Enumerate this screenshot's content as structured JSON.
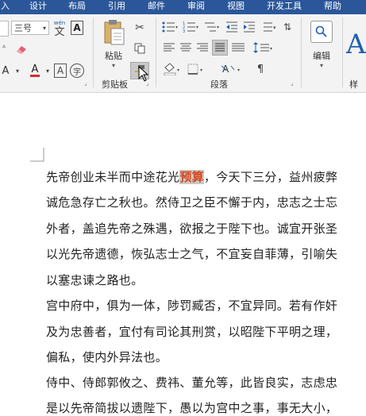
{
  "tabs": [
    "入",
    "设计",
    "布局",
    "引用",
    "邮件",
    "审阅",
    "视图",
    "开发工具",
    "帮助"
  ],
  "font": {
    "size_value": "三号",
    "wen_label": "wén"
  },
  "clipboard": {
    "paste_label": "粘贴",
    "group_label": "剪贴板"
  },
  "paragraph": {
    "group_label": "段落"
  },
  "editing": {
    "label": "编辑"
  },
  "styles": {
    "group_label": "样式"
  },
  "document": {
    "lines": [
      {
        "before": "先帝创业未半而中途花光",
        "highlight": "预算",
        "after": "，今天下三分，益州疲弊"
      },
      {
        "text": "诚危急存亡之秋也。然侍卫之臣不懈于内，忠志之士忘"
      },
      {
        "text": "外者，盖追先帝之殊遇，欲报之于陛下也。诚宜开张圣"
      },
      {
        "text": "以光先帝遗德，恢弘志士之气，不宜妄自菲薄，引喻失"
      },
      {
        "text": "以塞忠谏之路也。"
      },
      {
        "text": "宫中府中，俱为一体，陟罚臧否，不宜异同。若有作奸"
      },
      {
        "text": "及为忠善者，宜付有司论其刑赏，以昭陛下平明之理，"
      },
      {
        "text": "偏私，使内外异法也。"
      },
      {
        "text": "侍中、侍郎郭攸之、费祎、董允等，此皆良实，志虑忠"
      },
      {
        "text": "是以先帝简拔以遗陛下，愚以为宫中之事，事无大小，"
      }
    ]
  },
  "colors": {
    "accent": "#2b579a",
    "highlight_text": "#d9481c",
    "highlight_bg": "#c9c9c9"
  }
}
